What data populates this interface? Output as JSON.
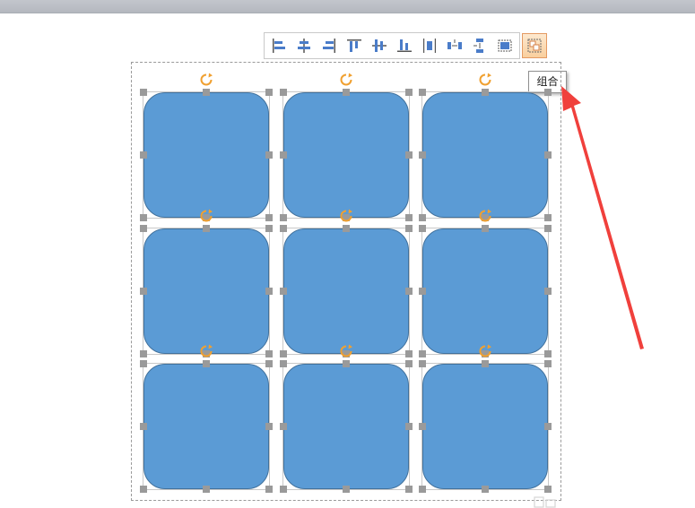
{
  "tooltip": {
    "text": "组合"
  },
  "toolbar": {
    "tools": [
      {
        "name": "align-left-icon"
      },
      {
        "name": "align-center-icon"
      },
      {
        "name": "align-right-icon"
      },
      {
        "name": "align-top-icon"
      },
      {
        "name": "align-middle-icon"
      },
      {
        "name": "align-bottom-icon"
      },
      {
        "name": "distribute-horizontal-icon"
      },
      {
        "name": "distribute-horizontal-space-icon"
      },
      {
        "name": "distribute-vertical-icon"
      },
      {
        "name": "select-frame-icon"
      }
    ],
    "group_button": {
      "name": "group-icon"
    }
  },
  "grid": {
    "rows": 3,
    "cols": 3
  },
  "colors": {
    "shape_fill": "#5b9bd5",
    "shape_border": "#41719c",
    "handle": "#9a9a9a",
    "rotate_handle": "#f0a030",
    "arrow": "#f0403c",
    "toolbar_icon": "#4a7cc9"
  }
}
